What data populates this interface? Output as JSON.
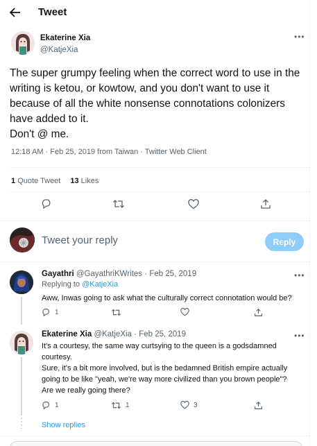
{
  "header": {
    "title": "Tweet"
  },
  "tweet": {
    "author_name": "Ekaterine Xia",
    "author_handle": "@KatjeXia",
    "text": "The super grumpy feeling when the correct word to use in the writing is ketou, or kowtow, and you don't want to use it because of all the white nonsense connotations colonizers have added to it.\nDon't @ me.",
    "meta": "12:18 AM · Feb 25, 2019 from Taiwan · Twitter Web Client",
    "quote_count": "1",
    "quote_label": "Quote Tweet",
    "like_count": "13",
    "like_label": "Likes"
  },
  "composer": {
    "placeholder": "Tweet your reply",
    "reply_button": "Reply"
  },
  "replies": [
    {
      "name": "Gayathri",
      "handle": "@GayathriKWrites",
      "sep": "·",
      "date": "Feb 25, 2019",
      "replying_prefix": "Replying to",
      "replying_to": "@KatjeXia",
      "text": "Aww, Inwas going to ask what the culturally correct connotation would be?",
      "reply_count": "1",
      "retweet_count": "",
      "like_count": ""
    },
    {
      "name": "Ekaterine Xia",
      "handle": "@KatjeXia",
      "sep": "·",
      "date": "Feb 25, 2019",
      "text": "It's a courtesy, the same way curtsying to the queen is a godsdamned courtesy.\nSure, it's a bit more involved, but is the bedamned British empire actually going to be like \"yeah, we're way more civilized than you brown people\"?\nAre we really going there?",
      "reply_count": "1",
      "retweet_count": "1",
      "like_count": "3"
    }
  ],
  "show_replies": "Show replies",
  "icons": {
    "back": "arrow-left-icon",
    "more": "more-horizontal-icon",
    "reply": "reply-bubble-icon",
    "retweet": "retweet-icon",
    "like": "heart-icon",
    "share": "share-icon"
  },
  "colors": {
    "accent": "#1d9bf0",
    "muted": "#536471",
    "reply_button_disabled": "#8ecdf8"
  }
}
